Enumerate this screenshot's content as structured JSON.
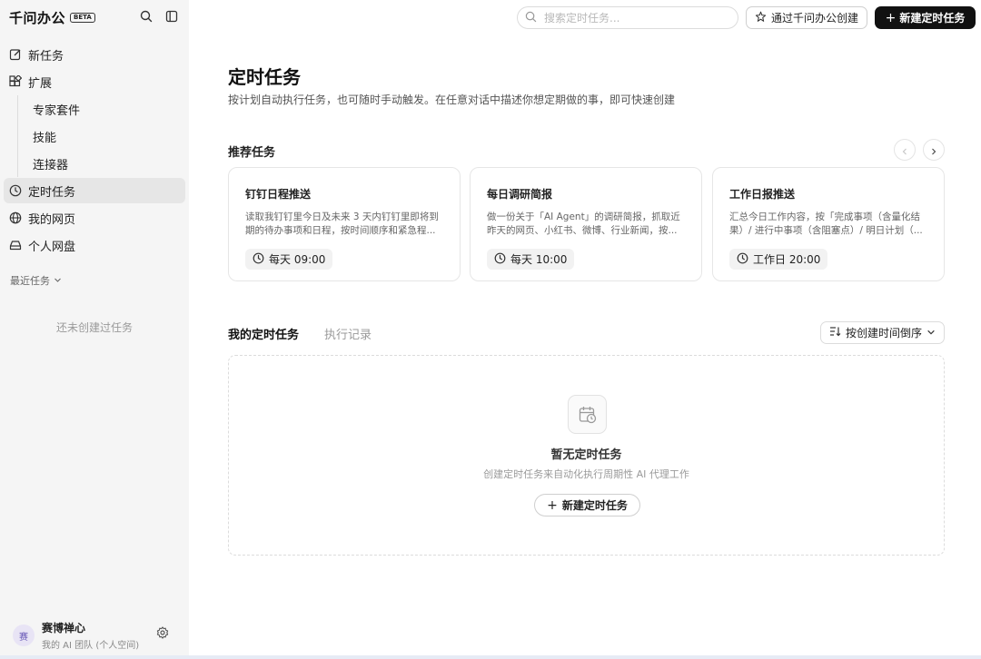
{
  "brand": {
    "name": "千问办公",
    "badge": "BETA"
  },
  "sidebar": {
    "items": [
      {
        "label": "新任务",
        "icon": "edit-icon"
      },
      {
        "label": "扩展",
        "icon": "extension-icon"
      },
      {
        "label": "专家套件"
      },
      {
        "label": "技能"
      },
      {
        "label": "连接器"
      },
      {
        "label": "定时任务",
        "icon": "clock-icon",
        "active": true
      },
      {
        "label": "我的网页",
        "icon": "globe-icon"
      },
      {
        "label": "个人网盘",
        "icon": "drive-icon"
      }
    ],
    "recent_label": "最近任务",
    "empty_recent": "还未创建过任务",
    "user": {
      "avatar": "赛",
      "name": "赛博禅心",
      "team": "我的 AI 团队 (个人空间)"
    }
  },
  "header": {
    "search_placeholder": "搜索定时任务...",
    "create_via_label": "通过千问办公创建",
    "new_task_label": "新建定时任务"
  },
  "main": {
    "title": "定时任务",
    "description": "按计划自动执行任务，也可随时手动触发。在任意对话中描述你想定期做的事，即可快速创建",
    "recommended_title": "推荐任务",
    "cards": [
      {
        "title": "钉钉日程推送",
        "desc": "读取我钉钉里今日及未来 3 天内钉钉里即将到期的待办事项和日程，按时间顺序和紧急程...",
        "time": "每天 09:00"
      },
      {
        "title": "每日调研简报",
        "desc": "做一份关于「AI Agent」的调研简报，抓取近昨天的网页、小红书、微博、行业新闻，按...",
        "time": "每天 10:00"
      },
      {
        "title": "工作日报推送",
        "desc": "汇总今日工作内容，按「完成事项（含量化结果）/ 进行中事项（含阻塞点）/ 明日计划（...",
        "time": "工作日 20:00"
      }
    ],
    "tabs": [
      "我的定时任务",
      "执行记录"
    ],
    "sort_label": "按创建时间倒序",
    "empty": {
      "title": "暂无定时任务",
      "desc": "创建定时任务来自动化执行周期性 AI 代理工作",
      "button": "新建定时任务"
    }
  }
}
